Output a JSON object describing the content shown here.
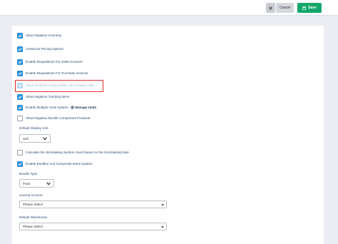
{
  "toolbar": {
    "close_label": "×",
    "cancel_label": "Cancel",
    "save_label": "Save"
  },
  "checkboxes": [
    {
      "label": "Allow Negative Inventory",
      "checked": true
    },
    {
      "label": "Advanced Pricing Options",
      "checked": true
    },
    {
      "label": "Enable Requisitions For Sales Invoices",
      "checked": true
    },
    {
      "label": "Enable Requisitions For Purchase Invoices",
      "checked": true
    },
    {
      "label": "Track Products Using Serial, Lot or Expiry Date",
      "checked": true,
      "disabled": true
    },
    {
      "label": "Allow Negative Tracking Items",
      "checked": true
    },
    {
      "label": "Enable Multiple Units System",
      "checked": true,
      "link": "Manage Units"
    },
    {
      "label": "Allow Negative Bundle Component Products",
      "checked": false
    },
    {
      "label": "Calculate the Stocktaking System count based on the Stocktaking Date",
      "checked": false
    },
    {
      "label": "Enable Bundles And Composite Items System",
      "checked": true
    }
  ],
  "fields": {
    "default_display_unit": {
      "label": "Default Display Unit",
      "value": "Sell"
    },
    "bundle_type": {
      "label": "Bundle Type",
      "value": "Pack"
    },
    "journal_account": {
      "label": "Journal Account",
      "value": "Please Select"
    },
    "default_warehouse": {
      "label": "Default Warehouse",
      "value": "Please Select"
    }
  },
  "colors": {
    "accent": "#2e8fd9",
    "save": "#14a86b",
    "highlight": "#d92b2b"
  }
}
